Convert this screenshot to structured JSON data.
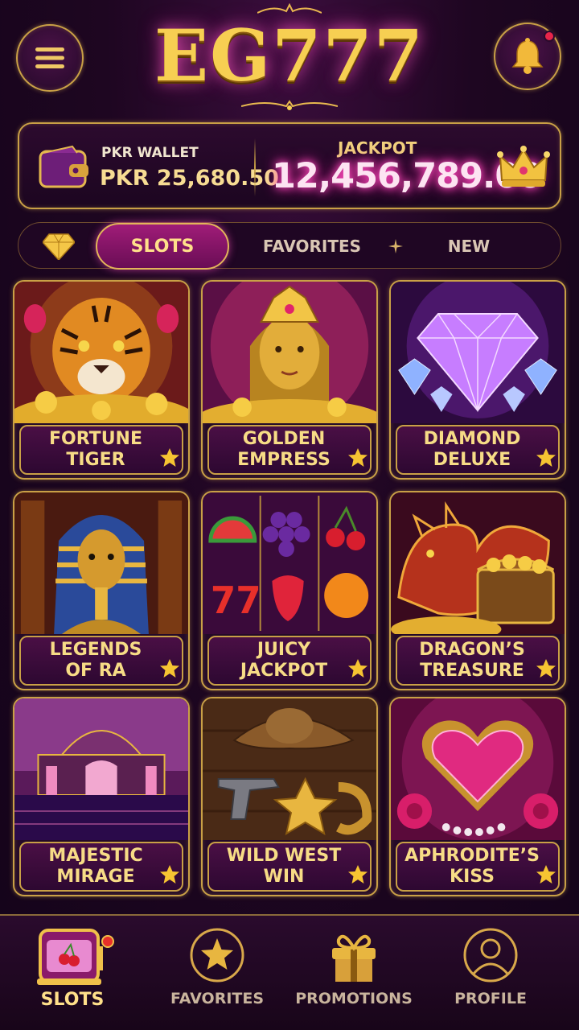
{
  "header": {
    "logo": "EG777",
    "menu_icon": "hamburger-menu-icon",
    "bell_icon": "bell-icon"
  },
  "wallet": {
    "label": "PKR WALLET",
    "amount": "PKR 25,680.50",
    "icon": "wallet-icon"
  },
  "jackpot": {
    "label": "JACKPOT",
    "amount": "12,456,789.00",
    "icon": "crown-icon"
  },
  "tabs": {
    "active": "SLOTS",
    "items": [
      {
        "label": "SLOTS"
      },
      {
        "label": "FAVORITES"
      },
      {
        "label": "NEW"
      }
    ]
  },
  "games": [
    {
      "line1": "FORTUNE",
      "line2": "TIGER"
    },
    {
      "line1": "GOLDEN",
      "line2": "EMPRESS"
    },
    {
      "line1": "DIAMOND",
      "line2": "DELUXE"
    },
    {
      "line1": "LEGENDS",
      "line2": "OF RA"
    },
    {
      "line1": "JUICY",
      "line2": "JACKPOT"
    },
    {
      "line1": "DRAGON’S",
      "line2": "TREASURE"
    },
    {
      "line1": "MAJESTIC",
      "line2": "MIRAGE"
    },
    {
      "line1": "WILD WEST",
      "line2": "WIN"
    },
    {
      "line1": "APHRODITE’S",
      "line2": "KISS"
    }
  ],
  "bottom_nav": [
    {
      "label": "SLOTS",
      "icon": "slot-machine-icon"
    },
    {
      "label": "FAVORITES",
      "icon": "star-icon"
    },
    {
      "label": "PROMOTIONS",
      "icon": "gift-icon"
    },
    {
      "label": "PROFILE",
      "icon": "user-icon"
    }
  ],
  "colors": {
    "gold": "#c9a046",
    "accent_pink": "#ff2aa8",
    "background": "#1e0621"
  }
}
